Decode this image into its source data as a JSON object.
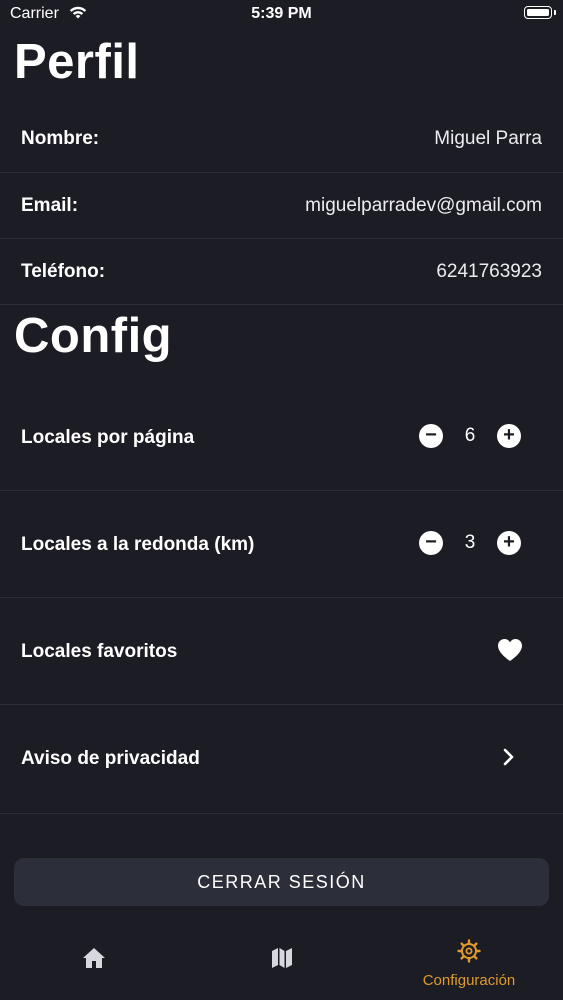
{
  "status_bar": {
    "carrier": "Carrier",
    "time": "5:39 PM"
  },
  "profile": {
    "title": "Perfil",
    "rows": [
      {
        "label": "Nombre:",
        "value": "Miguel Parra"
      },
      {
        "label": "Email:",
        "value": "miguelparradev@gmail.com"
      },
      {
        "label": "Teléfono:",
        "value": "6241763923"
      }
    ]
  },
  "config": {
    "title": "Config",
    "locales_por_pagina": {
      "label": "Locales por página",
      "value": "6"
    },
    "locales_a_la_redonda": {
      "label": "Locales a la redonda (km)",
      "value": "3"
    },
    "locales_favoritos": {
      "label": "Locales favoritos",
      "icon": "heart-icon"
    },
    "aviso_privacidad": {
      "label": "Aviso de privacidad",
      "icon": "chevron-right-icon"
    },
    "stepper_minus": "−",
    "stepper_plus": "+"
  },
  "logout_button": "CERRAR SESIÓN",
  "tab_bar": {
    "tabs": [
      {
        "icon": "home-icon",
        "label": ""
      },
      {
        "icon": "map-icon",
        "label": ""
      },
      {
        "icon": "gear-icon",
        "label": "Configuración",
        "active": true
      }
    ],
    "active_color": "#e09a2c"
  },
  "colors": {
    "background": "#1c1c24",
    "button_bg": "#2c2f39",
    "accent": "#e09a2c"
  }
}
